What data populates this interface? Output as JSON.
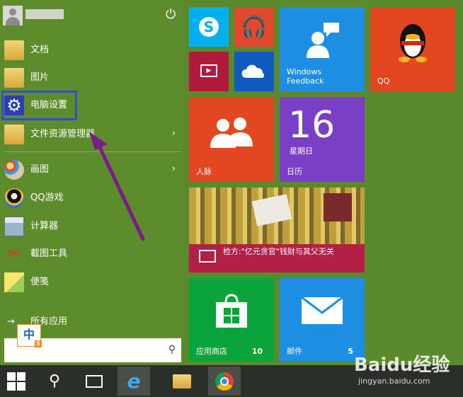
{
  "start_menu": {
    "items": [
      {
        "label": "文档",
        "icon": "folder-icon"
      },
      {
        "label": "图片",
        "icon": "folder-icon"
      },
      {
        "label": "电脑设置",
        "icon": "gear-icon"
      },
      {
        "label": "文件资源管理器",
        "icon": "folder-icon",
        "arrow": "›"
      },
      {
        "label": "画图",
        "icon": "paint-icon",
        "arrow": "›"
      },
      {
        "label": "QQ游戏",
        "icon": "qq-game-icon"
      },
      {
        "label": "计算器",
        "icon": "calculator-icon"
      },
      {
        "label": "截图工具",
        "icon": "scissors-icon"
      },
      {
        "label": "便笺",
        "icon": "sticky-note-icon"
      }
    ],
    "all_apps": {
      "arrow": "→",
      "label": "所有应用"
    },
    "ime": {
      "label": "中",
      "badge": "S"
    },
    "power_glyph": "⏻",
    "search_glyph": "⚲"
  },
  "tiles": {
    "windows_feedback": "Windows\nFeedback",
    "qq": "QQ",
    "contacts": "人脉",
    "calendar_day": "16",
    "calendar_weekday": "星期日",
    "calendar_label": "日历",
    "news_headline": "检方:\"亿元贪官\"钱财与其父无关",
    "store_label": "应用商店",
    "store_count": "10",
    "mail_label": "邮件",
    "mail_count": "5"
  },
  "colors": {
    "background": "#5b8a2e",
    "skype": "#00aff0",
    "music": "#e0492c",
    "video": "#b11a3d",
    "onedrive": "#0f5bc0",
    "feedback": "#1f8fe6",
    "qq": "#e2471f",
    "contacts": "#e2471f",
    "calendar": "#7a3fc7",
    "news": "#b41f45",
    "store": "#0aa53a",
    "mail": "#1f8fe6",
    "highlight": "#2f4fd6",
    "arrow": "#7a1d8a"
  },
  "watermark": {
    "brand": "Baidu经验",
    "url": "jingyan.baidu.com"
  }
}
